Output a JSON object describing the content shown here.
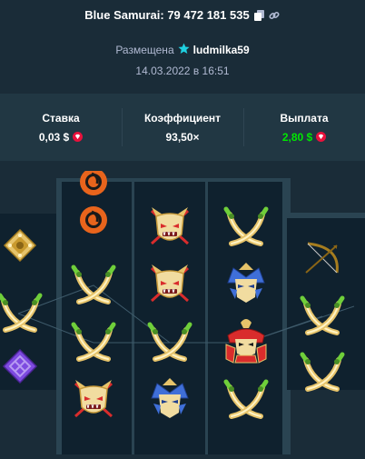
{
  "header": {
    "title": "Blue Samurai: 79 472 181 535",
    "copy_icon": "copy-icon",
    "link_icon": "link-icon",
    "posted_label": "Размещена",
    "verified_icon": "verified-star-icon",
    "username": "ludmilka59",
    "date": "14.03.2022 в 16:51"
  },
  "stats": {
    "bet_label": "Ставка",
    "bet_value": "0,03 $",
    "multiplier_label": "Коэффициент",
    "multiplier_value": "93,50×",
    "payout_label": "Выплата",
    "payout_value": "2,80 $",
    "currency_icon": "ruby-icon"
  },
  "board": {
    "reels": [
      {
        "column": 1,
        "symbols": [
          "shuriken",
          "crossed-swords",
          "purple-diamond"
        ]
      },
      {
        "column": 2,
        "symbols": [
          "orange-mon",
          "orange-mon",
          "crossed-swords",
          "crossed-swords",
          "oni-mask"
        ]
      },
      {
        "column": 3,
        "symbols": [
          "oni-mask",
          "oni-mask",
          "crossed-swords",
          "blue-samurai-helmet"
        ]
      },
      {
        "column": 4,
        "symbols": [
          "crossed-swords",
          "blue-samurai-helmet",
          "red-samurai",
          "crossed-swords"
        ]
      },
      {
        "column": 5,
        "symbols": [
          "bow-and-arrow",
          "crossed-swords",
          "crossed-swords"
        ]
      }
    ],
    "colors": {
      "reel_frame": "#2a4452",
      "cell": "#0f212e",
      "gold": "#e6c36a",
      "red": "#d92c2c",
      "green": "#6fcf3a",
      "blue": "#3f6fd8",
      "purple": "#7d4ae0",
      "orange": "#e8641c"
    }
  }
}
